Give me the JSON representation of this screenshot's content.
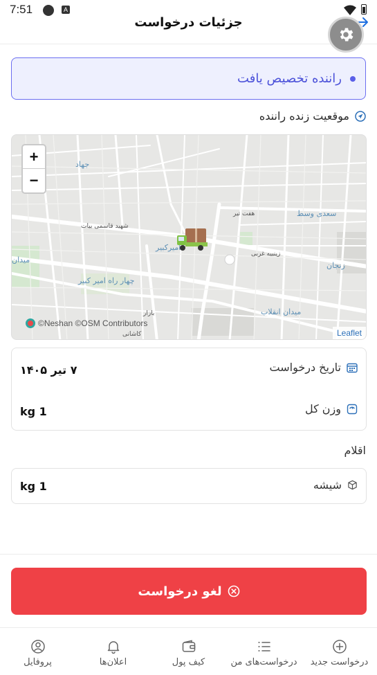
{
  "status_bar": {
    "time": "7:51",
    "a_badge": "A"
  },
  "header": {
    "title": "جزئیات درخواست"
  },
  "status": {
    "text": "راننده تخصیص یافت",
    "accent": "#5a5fe8"
  },
  "live_location": {
    "label": "موقعیت زنده راننده"
  },
  "map": {
    "zoom_in": "+",
    "zoom_out": "−",
    "attribution": "©Neshan ©OSM Contributors",
    "leaflet": "Leaflet",
    "labels": [
      "جهاد",
      "شهید قاسمی بیات",
      "امیرکبیر",
      "چهار راه امیر کبیر",
      "هفت تیر",
      "سعدی وسط",
      "زنجان",
      "زینبیه غربی",
      "میدان انقلاب",
      "بازار",
      "کاشانی",
      "میدان"
    ]
  },
  "details": {
    "date_label": "تاریخ درخواست",
    "date_value": "۷ تیر ۱۴۰۵",
    "weight_label": "وزن کل",
    "weight_value": "1 kg"
  },
  "items": {
    "title": "اقلام",
    "list": [
      {
        "name": "شیشه",
        "weight": "1 kg"
      }
    ]
  },
  "cancel": {
    "label": "لغو درخواست",
    "color": "#ef4146"
  },
  "bottom_nav": {
    "items": [
      {
        "label": "درخواست جدید",
        "icon": "plus-circle-icon"
      },
      {
        "label": "درخواست‌های من",
        "icon": "list-icon"
      },
      {
        "label": "کیف پول",
        "icon": "wallet-icon"
      },
      {
        "label": "اعلان‌ها",
        "icon": "bell-icon"
      },
      {
        "label": "پروفایل",
        "icon": "profile-icon"
      }
    ]
  }
}
